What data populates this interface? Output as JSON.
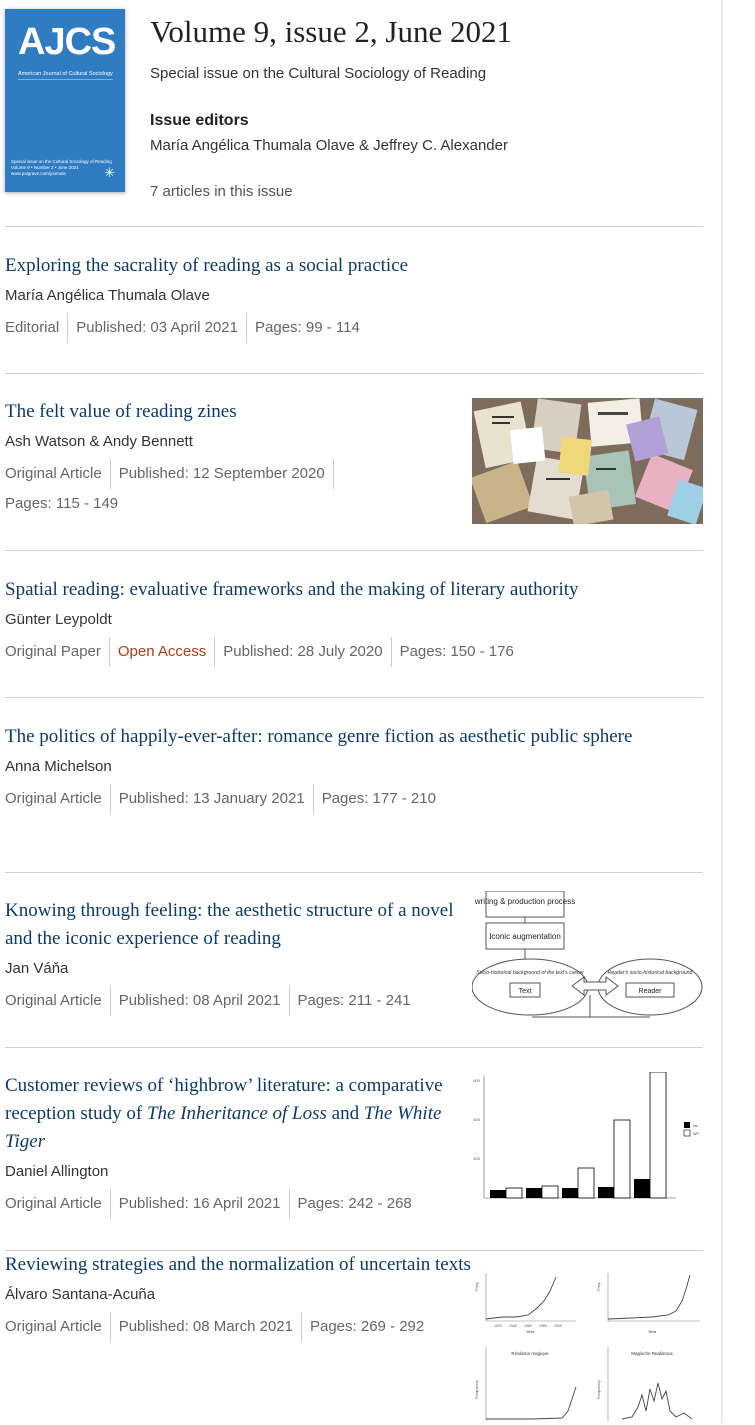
{
  "cover": {
    "title": "AJCS",
    "journal": "American Journal of Cultural Sociology",
    "issue_text": "Special issue on the Cultural Sociology of Reading",
    "issue_meta": "Volume 9 • Number 2 • June 2021",
    "site": "www.palgrave.com/journals",
    "color": "#2f7cc3"
  },
  "volume": {
    "title": "Volume 9, issue 2, June 2021",
    "subtitle": "Special issue on the Cultural Sociology of Reading",
    "editors_heading": "Issue editors",
    "editors": "María Angélica Thumala Olave & Jeffrey C. Alexander",
    "article_count": "7 articles in this issue"
  },
  "colors": {
    "link": "#0b3a6b",
    "open_access": "#b23c17",
    "rule": "#d0d0d0"
  },
  "articles": [
    {
      "title": "Exploring the sacrality of reading as a social practice",
      "authors": "María Angélica Thumala Olave",
      "type": "Editorial",
      "published": "Published: 03 April 2021",
      "pages": "Pages: 99 - 114"
    },
    {
      "title": "The felt value of reading zines",
      "authors": "Ash Watson & Andy Bennett",
      "type": "Original Article",
      "published": "Published: 12 September 2020",
      "pages": "Pages: 115 - 149",
      "thumbnail": "zines-collage-photo"
    },
    {
      "title": "Spatial reading: evaluative frameworks and the making of literary authority",
      "authors": "Günter Leypoldt",
      "type": "Original Paper",
      "access": "Open Access",
      "published": "Published: 28 July 2020",
      "pages": "Pages: 150 - 176"
    },
    {
      "title": "The politics of happily-ever-after: romance genre fiction as aesthetic public sphere",
      "authors": "Anna Michelson",
      "type": "Original Article",
      "published": "Published: 13 January 2021",
      "pages": "Pages: 177 - 210"
    },
    {
      "title": "Knowing through feeling: the aesthetic structure of a novel and the iconic experience of reading",
      "authors": "Jan Váňa",
      "type": "Original Article",
      "published": "Published: 08 April 2021",
      "pages": "Pages: 211 - 241",
      "thumbnail": "diagram",
      "figure": {
        "box1": "writing & production process",
        "box2": "Iconic augmentation",
        "ellipse_left": "Socio-historical background of the text's career",
        "box_text": "Text",
        "ellipse_right": "Reader's socio-historical background",
        "box_reader": "Reader"
      }
    },
    {
      "title_pre": "Customer reviews of ‘highbrow’ literature: a comparative reception study of ",
      "title_em1": "The Inheritance of Loss",
      "title_mid": " and ",
      "title_em2": "The White Tiger",
      "authors": "Daniel Allington",
      "type": "Original Article",
      "published": "Published: 16 April 2021",
      "pages": "Pages: 242 - 268",
      "thumbnail": "bar-chart",
      "figure": {
        "ticks": [
          "600",
          "400",
          "200"
        ],
        "legend": [
          "IoL",
          "WT"
        ]
      }
    },
    {
      "title": "Reviewing strategies and the normalization of uncertain texts",
      "authors": "Álvaro Santana-Acuña",
      "type": "Original Article",
      "published": "Published: 08 March 2021",
      "pages": "Pages: 269 - 292",
      "thumbnail": "ngram-charts",
      "figure": {
        "ylabel_top": "Freq.",
        "xlabel": "Year",
        "x_ticks": [
          "1920",
          "1940",
          "1960",
          "1980",
          "2000"
        ],
        "panel3": "Réalisme magique",
        "panel4": "Magische Realismus",
        "ylabel_bottom": "Frequency"
      }
    }
  ]
}
